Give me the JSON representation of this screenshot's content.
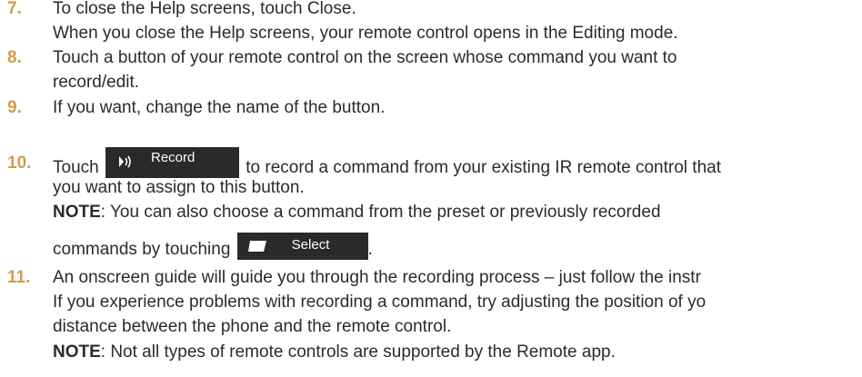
{
  "steps": [
    {
      "number": "7.",
      "lines": [
        "To close the Help screens, touch Close.",
        "When you close the Help screens, your remote control opens in the Editing mode."
      ]
    },
    {
      "number": "8.",
      "lines": [
        "Touch a button of your remote control on the screen whose command you want to",
        "record/edit."
      ]
    },
    {
      "number": "9.",
      "lines": [
        "If you want, change the name of the button."
      ]
    },
    {
      "number": "10.",
      "line1_before": "Touch",
      "line1_after": "to record a command from your existing IR remote control that",
      "line2": "you want to assign to this button.",
      "note_label": "NOTE",
      "note_text": ": You can also choose a command from the preset or previously recorded",
      "note_line2": "commands by touching",
      "note_line2_end": "."
    },
    {
      "number": "11.",
      "lines": [
        "An onscreen guide will guide you through the recording process – just follow the instr",
        "If you experience problems with recording a command, try adjusting the position of yo",
        "distance between the phone and the remote control."
      ],
      "note_label": "NOTE",
      "note_text": ": Not all types of remote controls are supported by the Remote app."
    }
  ],
  "buttons": {
    "record": {
      "label": "Record",
      "icon": "broadcast-icon"
    },
    "select": {
      "label": "Select",
      "icon": "folder-icon"
    }
  },
  "colors": {
    "step_number": "#d39a4e",
    "text": "#2b2b2b",
    "button_bg": "#2a2a2a",
    "button_text": "#ffffff"
  }
}
